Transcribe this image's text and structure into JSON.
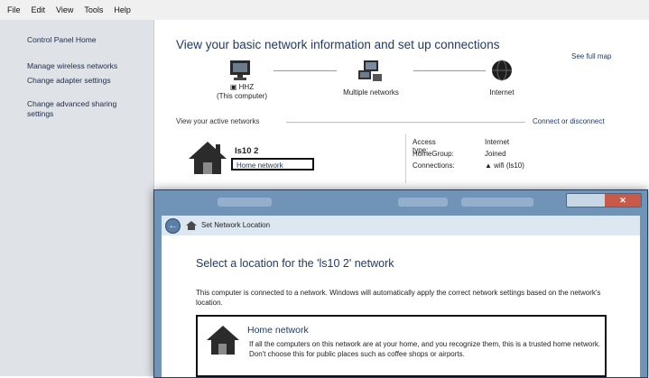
{
  "menu": [
    "File",
    "Edit",
    "View",
    "Tools",
    "Help"
  ],
  "sidebar": {
    "home": "Control Panel Home",
    "items": [
      "Manage wireless networks",
      "Change adapter settings",
      "Change advanced sharing settings"
    ]
  },
  "main": {
    "title": "View your basic network information and set up connections",
    "see_full_map": "See full map",
    "computer_name": "HHZ",
    "computer_sub": "(This computer)",
    "middle_node": "Multiple networks",
    "internet_node": "Internet",
    "active_networks_label": "View your active networks",
    "connect_link": "Connect or disconnect",
    "network_name": "ls10  2",
    "network_type": "Home network",
    "props": [
      {
        "k": "Access type:",
        "v": "Internet"
      },
      {
        "k": "HomeGroup:",
        "v": "Joined"
      },
      {
        "k": "Connections:",
        "v": "wifi (ls10)"
      }
    ]
  },
  "dialog": {
    "close": "✕",
    "title": "Set Network Location",
    "heading": "Select a location for the 'ls10  2' network",
    "paragraph": "This computer is connected to a network. Windows will automatically apply the correct network settings based on the network's location.",
    "option_title": "Home network",
    "option_desc": "If all the computers on this network are at your home, and you recognize them, this is a trusted home network. Don't choose this for public places such as coffee shops or airports."
  },
  "colors": {
    "sidebar": "#dfe3e7",
    "title_blue": "#1f3a6a",
    "dialog_frame": "#6f94b8"
  }
}
